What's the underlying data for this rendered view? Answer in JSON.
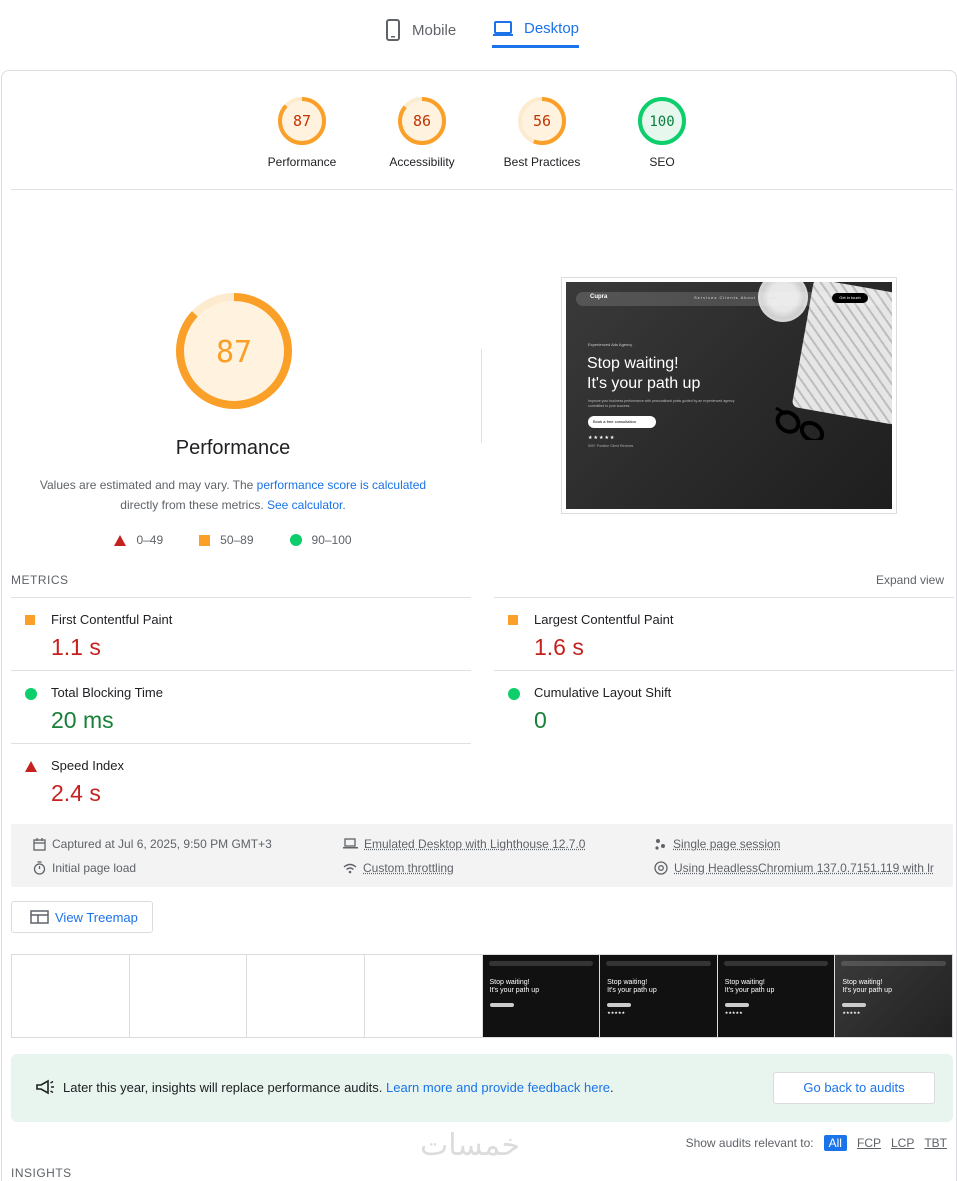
{
  "tabs": {
    "mobile": "Mobile",
    "desktop": "Desktop"
  },
  "gauges": [
    {
      "score": "87",
      "label": "Performance",
      "status": "average"
    },
    {
      "score": "86",
      "label": "Accessibility",
      "status": "average"
    },
    {
      "score": "56",
      "label": "Best Practices",
      "status": "average"
    },
    {
      "score": "100",
      "label": "SEO",
      "status": "pass"
    }
  ],
  "performance": {
    "score": "87",
    "score_fraction": 0.87,
    "title": "Performance",
    "estimate_prefix": "Values are estimated and may vary. The ",
    "estimate_link": "performance score is calculated",
    "estimate_middle": "directly from these metrics. ",
    "calculator_link": "See calculator."
  },
  "legend": {
    "fail": "0–49",
    "average": "50–89",
    "pass": "90–100"
  },
  "screenshot": {
    "logo": "Cupra",
    "menu": "Services  Clients  About  Contact",
    "nav_button": "Get in touch",
    "small": "Experienced Ads Agency",
    "headline_1": "Stop waiting!",
    "headline_2": "It's your path up",
    "paragraph": "Improve your business performance with personalised posts guided by an experienced agency committed to your success.",
    "cta": "Book a free consultation",
    "stars": "★★★★★",
    "reviews": "500+ Positive Client Reviews"
  },
  "metrics": {
    "title": "METRICS",
    "expand": "Expand view",
    "items": [
      {
        "name": "First Contentful Paint",
        "value": "1.1 s",
        "status": "average"
      },
      {
        "name": "Largest Contentful Paint",
        "value": "1.6 s",
        "status": "average"
      },
      {
        "name": "Total Blocking Time",
        "value": "20 ms",
        "status": "pass"
      },
      {
        "name": "Cumulative Layout Shift",
        "value": "0",
        "status": "pass"
      },
      {
        "name": "Speed Index",
        "value": "2.4 s",
        "status": "fail"
      }
    ]
  },
  "info": {
    "captured": "Captured at Jul 6, 2025, 9:50 PM GMT+3",
    "initial": "Initial page load",
    "emulated": "Emulated Desktop with Lighthouse 12.7.0",
    "throttling": "Custom throttling",
    "session": "Single page session",
    "browser": "Using HeadlessChromium 137.0.7151.119 with lr"
  },
  "treemap": {
    "label": "View Treemap"
  },
  "filmstrip": {
    "headline_1": "Stop waiting!",
    "headline_2": "It's your path up"
  },
  "notice": {
    "text": "Later this year, insights will replace performance audits. ",
    "link": "Learn more and provide feedback here",
    "period": ".",
    "button": "Go back to audits"
  },
  "watermark": "خمسات",
  "filter": {
    "label": "Show audits relevant to:",
    "all": "All",
    "fcp": "FCP",
    "lcp": "LCP",
    "tbt": "TBT"
  },
  "insights": {
    "title": "INSIGHTS"
  },
  "colors": {
    "average": "#fa9f28",
    "pass": "#0cce6b",
    "fail": "#c5221f",
    "link": "#1a73e8"
  }
}
